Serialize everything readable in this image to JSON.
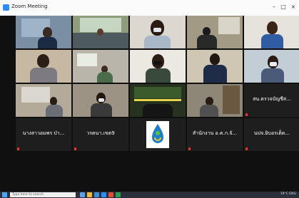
{
  "window": {
    "title": "Zoom Meeting"
  },
  "tiles": [
    {
      "label": ""
    },
    {
      "label": ""
    },
    {
      "label": ""
    },
    {
      "label": ""
    },
    {
      "label": ""
    },
    {
      "label": ""
    },
    {
      "label": ""
    },
    {
      "label": ""
    },
    {
      "label": ""
    },
    {
      "label": ""
    },
    {
      "label": ""
    },
    {
      "label": ""
    },
    {
      "label": ""
    },
    {
      "label": ""
    },
    {
      "label": "",
      "name": "สน.ตรวจบัญชีส..."
    },
    {
      "label": "",
      "name": "นางสาวอมพร ป่า..."
    },
    {
      "label": "",
      "name": "วรดนา.เขต9"
    },
    {
      "label": ""
    },
    {
      "label": "",
      "name": "สำนักงาน อ.ค.ก.จั..."
    },
    {
      "label": "",
      "name": "นปจ.ยิบอรเต็ด..."
    }
  ],
  "taskbar": {
    "search_placeholder": "Type here to search",
    "tray_text": "19°C  ENG"
  }
}
